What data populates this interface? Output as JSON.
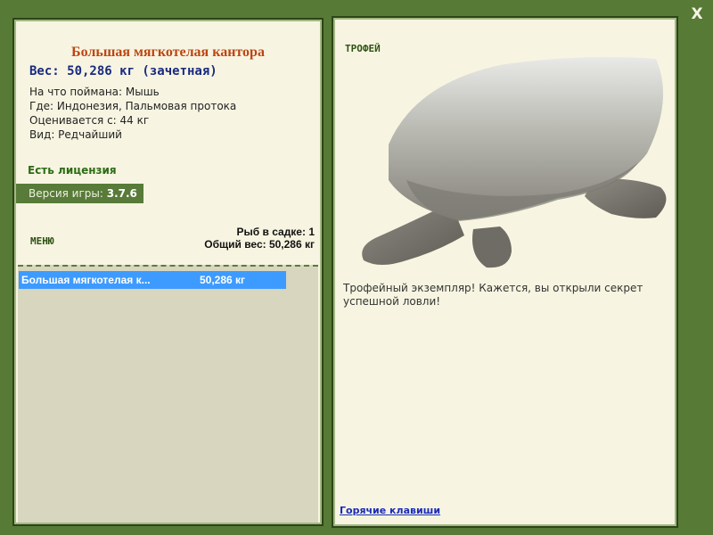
{
  "window": {
    "close_label": "X"
  },
  "fish_card": {
    "name": "Большая мягкотелая кантора",
    "weight_line": "Вес: 50,286 кг (зачетная)",
    "bait_line": "На что поймана: Мышь",
    "location_line": "Где: Индонезия, Пальмовая протока",
    "rated_line": "Оценивается с: 44 кг",
    "kind_line": "Вид: Редчайший"
  },
  "license_text": "Есть лицензия",
  "version": {
    "label": "Версия игры:",
    "value": "3.7.6"
  },
  "menu_label": "МЕНЮ",
  "keepnet": {
    "count_line": "Рыб в садке: 1",
    "total_line": "Общий вес: 50,286 кг"
  },
  "fish_list": [
    {
      "name": "Большая мягкотелая к...",
      "weight": "50,286 кг"
    }
  ],
  "trophy": {
    "label": "ТРОФЕЙ",
    "image_icon": "softshell-turtle-image",
    "description": "Трофейный экземпляр! Кажется, вы открыли секрет успешной ловли!"
  },
  "hotkeys_link": "Горячие клавиши",
  "colors": {
    "frame_green": "#577a36",
    "panel_bg": "#f7f5e1",
    "list_bg": "#d8d6be",
    "title_orange": "#bd4512",
    "weight_blue": "#1a2a80",
    "selection_blue": "#3d9bff"
  }
}
